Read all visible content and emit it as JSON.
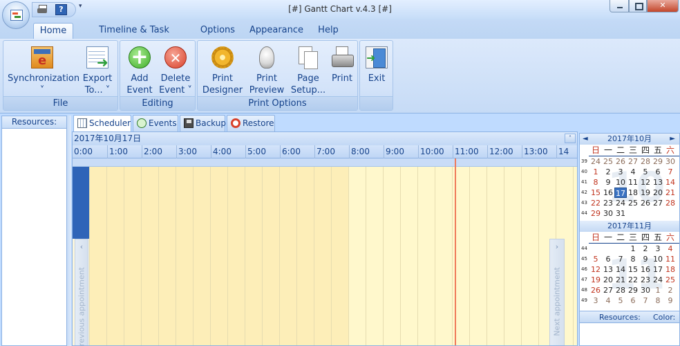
{
  "window": {
    "title": "[#] Gantt Chart v.4.3 [#]"
  },
  "qat": {
    "arrow": "▾"
  },
  "ribbon": {
    "tabs": [
      {
        "label": "Home",
        "active": true
      },
      {
        "label": "Timeline & Task Options"
      },
      {
        "label": "Options"
      },
      {
        "label": "Appearance"
      },
      {
        "label": "Help"
      }
    ],
    "groups": {
      "file": {
        "label": "File",
        "sync": {
          "line1": "Synchronization",
          "line2": "˅"
        },
        "export": {
          "line1": "Export",
          "line2": "To... ˅"
        }
      },
      "editing": {
        "label": "Editing",
        "add": {
          "line1": "Add",
          "line2": "Event"
        },
        "delete": {
          "line1": "Delete",
          "line2": "Event ˅"
        }
      },
      "print": {
        "label": "Print Options",
        "designer": {
          "line1": "Print",
          "line2": "Designer"
        },
        "preview": {
          "line1": "Print",
          "line2": "Preview"
        },
        "page": {
          "line1": "Page",
          "line2": "Setup..."
        },
        "print": {
          "line1": "Print"
        }
      },
      "exit": {
        "line1": "Exit"
      }
    }
  },
  "resources": {
    "title": "Resources:"
  },
  "scheduler_tabs": [
    {
      "label": "Scheduler",
      "icon": "scheduler-icon",
      "active": true
    },
    {
      "label": "Events",
      "icon": "events-icon"
    },
    {
      "label": "Backup",
      "icon": "backup-icon"
    },
    {
      "label": "Restore",
      "icon": "restore-icon"
    }
  ],
  "scheduler": {
    "date": "2017年10月17日",
    "hours": [
      "0:00",
      "1:00",
      "2:00",
      "3:00",
      "4:00",
      "5:00",
      "6:00",
      "7:00",
      "8:00",
      "9:00",
      "10:00",
      "11:00",
      "12:00",
      "13:00",
      "14"
    ],
    "prev_label": "Previous appointment",
    "next_label": "Next appointment",
    "collapse": "˄",
    "chev_prev": "‹",
    "chev_next": "›"
  },
  "calendar": {
    "weekdays": [
      "日",
      "一",
      "二",
      "三",
      "四",
      "五",
      "六"
    ],
    "months": [
      {
        "title": "2017年10月",
        "bg": "10",
        "weeks": [
          {
            "num": "39",
            "days": [
              "24",
              "25",
              "26",
              "27",
              "28",
              "29",
              "30"
            ],
            "other": [
              true,
              true,
              true,
              true,
              true,
              true,
              true
            ]
          },
          {
            "num": "40",
            "days": [
              "1",
              "2",
              "3",
              "4",
              "5",
              "6",
              "7"
            ]
          },
          {
            "num": "41",
            "days": [
              "8",
              "9",
              "10",
              "11",
              "12",
              "13",
              "14"
            ]
          },
          {
            "num": "42",
            "days": [
              "15",
              "16",
              "17",
              "18",
              "19",
              "20",
              "21"
            ]
          },
          {
            "num": "43",
            "days": [
              "22",
              "23",
              "24",
              "25",
              "26",
              "27",
              "28"
            ]
          },
          {
            "num": "44",
            "days": [
              "29",
              "30",
              "31",
              "",
              "",
              "",
              ""
            ]
          }
        ],
        "today": "17"
      },
      {
        "title": "2017年11月",
        "bg": "11",
        "weeks": [
          {
            "num": "44",
            "days": [
              "",
              "",
              "",
              "1",
              "2",
              "3",
              "4"
            ]
          },
          {
            "num": "45",
            "days": [
              "5",
              "6",
              "7",
              "8",
              "9",
              "10",
              "11"
            ]
          },
          {
            "num": "46",
            "days": [
              "12",
              "13",
              "14",
              "15",
              "16",
              "17",
              "18"
            ]
          },
          {
            "num": "47",
            "days": [
              "19",
              "20",
              "21",
              "22",
              "23",
              "24",
              "25"
            ]
          },
          {
            "num": "48",
            "days": [
              "26",
              "27",
              "28",
              "29",
              "30",
              "1",
              "2"
            ]
          },
          {
            "num": "49",
            "days": [
              "3",
              "4",
              "5",
              "6",
              "7",
              "8",
              "9"
            ]
          }
        ]
      }
    ],
    "nav_prev": "◄",
    "nav_next": "►",
    "resources_label": "Resources:",
    "color_label": "Color:"
  }
}
